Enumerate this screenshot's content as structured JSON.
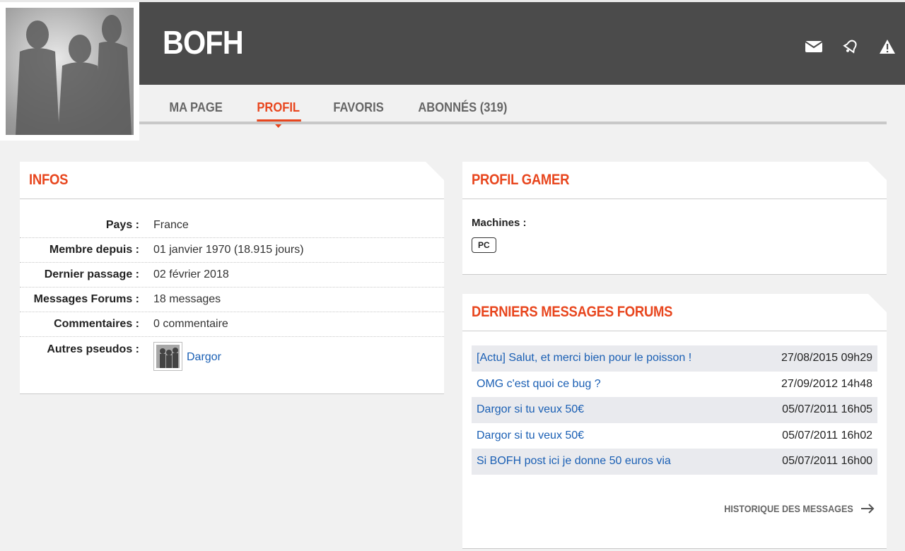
{
  "header": {
    "username": "BOFH",
    "icons": [
      "mail-icon",
      "bell-icon",
      "warning-icon"
    ]
  },
  "tabs": [
    {
      "label": "MA PAGE",
      "active": false
    },
    {
      "label": "PROFIL",
      "active": true
    },
    {
      "label": "FAVORIS",
      "active": false
    },
    {
      "label": "ABONNÉS (319)",
      "active": false
    }
  ],
  "infos": {
    "title": "INFOS",
    "rows": [
      {
        "label": "Pays :",
        "value": "France"
      },
      {
        "label": "Membre depuis :",
        "value": "01 janvier 1970 (18.915 jours)"
      },
      {
        "label": "Dernier passage :",
        "value": "02 février 2018"
      },
      {
        "label": "Messages Forums :",
        "value": "18 messages"
      },
      {
        "label": "Commentaires :",
        "value": "0 commentaire"
      }
    ],
    "aliases_label": "Autres pseudos :",
    "aliases": [
      "Dargor"
    ]
  },
  "gamer": {
    "title": "PROFIL GAMER",
    "machines_label": "Machines :",
    "machines": [
      "PC"
    ]
  },
  "forums": {
    "title": "DERNIERS MESSAGES FORUMS",
    "messages": [
      {
        "title": "[Actu] Salut, et merci bien pour le poisson !",
        "date": "27/08/2015 09h29"
      },
      {
        "title": "OMG c'est quoi ce bug ?",
        "date": "27/09/2012 14h48"
      },
      {
        "title": "Dargor si tu veux 50€",
        "date": "05/07/2011 16h05"
      },
      {
        "title": "Dargor si tu veux 50€",
        "date": "05/07/2011 16h02"
      },
      {
        "title": "Si BOFH post ici je donne 50 euros via",
        "date": "05/07/2011 16h00"
      }
    ],
    "history_label": "HISTORIQUE DES MESSAGES"
  },
  "colors": {
    "accent": "#e8461e",
    "header_bg": "#4b4b4b",
    "link": "#1a5fb4",
    "page_bg": "#f1f1f1"
  }
}
